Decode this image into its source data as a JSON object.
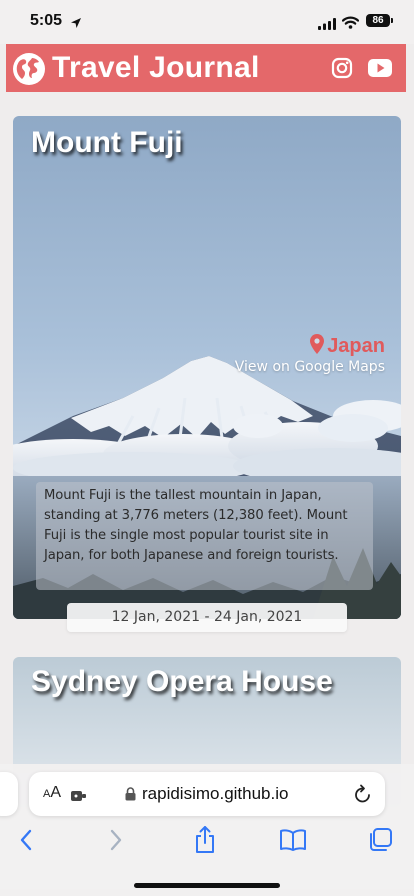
{
  "status_bar": {
    "time": "5:05",
    "battery": "86"
  },
  "header": {
    "title": "Travel Journal",
    "brand_color": "#e4686a",
    "icons": [
      "globe-icon",
      "instagram-icon",
      "youtube-icon"
    ]
  },
  "entries": [
    {
      "title": "Mount Fuji",
      "country": "Japan",
      "maps_link": "View on Google Maps",
      "description": "Mount Fuji is the tallest mountain in Japan, standing at 3,776 meters (12,380 feet). Mount Fuji is the single most popular tourist site in Japan, for both Japanese and foreign tourists.",
      "dates": "12 Jan, 2021 - 24 Jan, 2021"
    },
    {
      "title": "Sydney Opera House"
    }
  ],
  "browser": {
    "text_size_small": "A",
    "text_size_large": "A",
    "url": "rapidisimo.github.io",
    "accent_color": "#3478f6"
  }
}
